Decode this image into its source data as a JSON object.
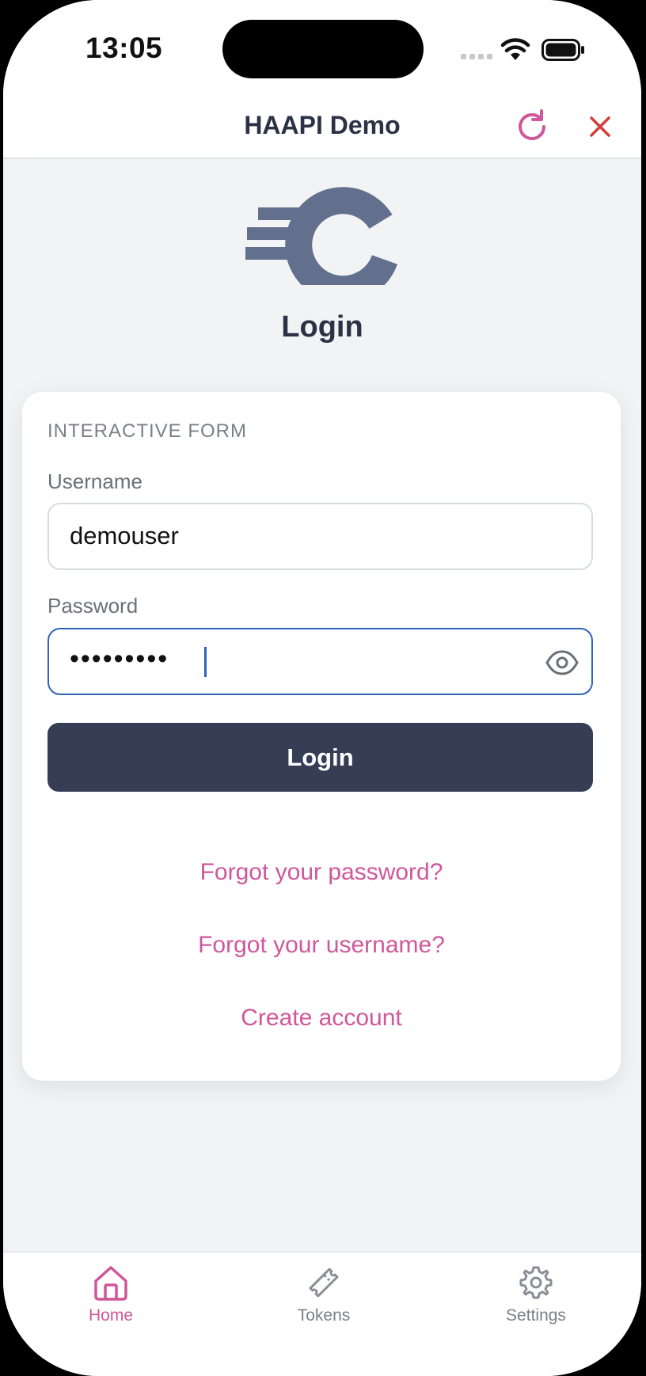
{
  "status_bar": {
    "time": "13:05"
  },
  "header": {
    "title": "HAAPI Demo"
  },
  "page": {
    "title": "Login"
  },
  "form": {
    "section_label": "INTERACTIVE FORM",
    "username_label": "Username",
    "username_value": "demouser",
    "password_label": "Password",
    "password_masked": "•••••••••",
    "submit_label": "Login"
  },
  "links": {
    "forgot_password": "Forgot your password?",
    "forgot_username": "Forgot your username?",
    "create_account": "Create account"
  },
  "tabs": [
    {
      "label": "Home",
      "icon": "home-icon",
      "active": true
    },
    {
      "label": "Tokens",
      "icon": "ticket-icon",
      "active": false
    },
    {
      "label": "Settings",
      "icon": "gear-icon",
      "active": false
    }
  ],
  "colors": {
    "accent": "#d0579b",
    "primary_button": "#353e55",
    "focus_border": "#2e63b8",
    "close_icon": "#d23c3c",
    "logo": "#63708d"
  }
}
